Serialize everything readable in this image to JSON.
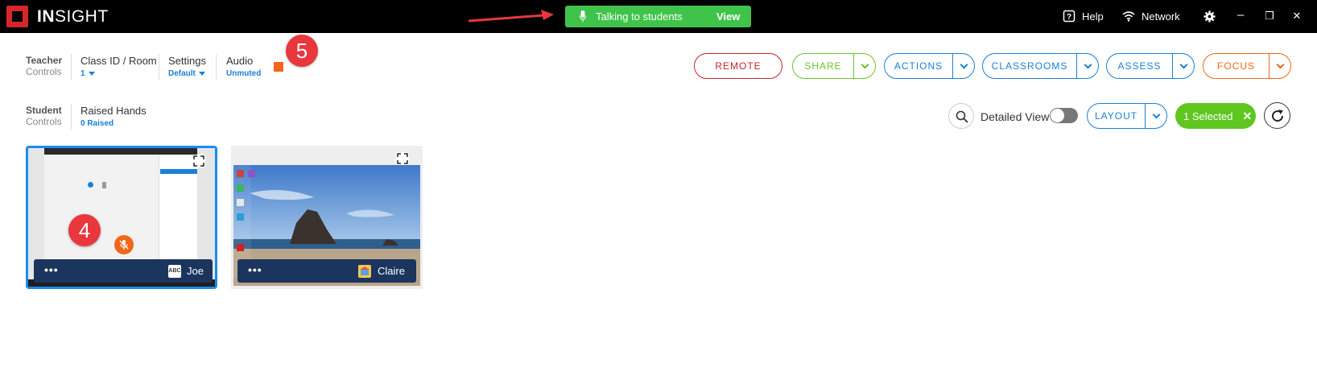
{
  "titlebar": {
    "brand_bold": "IN",
    "brand_rest": "SIGHT",
    "notice_text": "Talking to students",
    "notice_action": "View",
    "help_label": "Help",
    "network_label": "Network",
    "minimize": "–",
    "restore": "❐",
    "close": "✕"
  },
  "teacher_controls": {
    "heading": "Teacher",
    "subheading": "Controls",
    "class_label": "Class ID / Room",
    "class_value": "1",
    "settings_label": "Settings",
    "settings_value": "Default",
    "audio_label": "Audio",
    "audio_value": "Unmuted"
  },
  "annotations": {
    "badge_five": "5",
    "badge_four": "4"
  },
  "actions": {
    "remote": "REMOTE",
    "share": "SHARE",
    "actions": "ACTIONS",
    "classrooms": "CLASSROOMS",
    "assess": "ASSESS",
    "focus": "FOCUS",
    "layout": "LAYOUT"
  },
  "student_controls": {
    "heading": "Student",
    "subheading": "Controls",
    "raised_label": "Raised Hands",
    "raised_value": "0 Raised",
    "detailed_view": "Detailed View",
    "detailed_view_on": false,
    "selected_label": "1 Selected",
    "selected_clear": "✕"
  },
  "students": [
    {
      "name": "Joe",
      "avatar_text": "ABC",
      "more": "•••",
      "selected": true,
      "audio_muted": true
    },
    {
      "name": "Claire",
      "avatar_text": "",
      "more": "•••",
      "selected": false,
      "audio_muted": false
    }
  ],
  "colors": {
    "remote": "#c8242b",
    "share": "#6cc32e",
    "blue": "#1a7fd9",
    "focus": "#f0661a",
    "notice": "#3fc34a",
    "selected": "#5fc61f",
    "badge": "#e8373d"
  },
  "icons": [
    "microphone-icon",
    "help-icon",
    "network-icon",
    "gear-icon",
    "search-icon",
    "refresh-icon",
    "expand-icon",
    "muted-mic-icon",
    "chevron-down-icon"
  ]
}
